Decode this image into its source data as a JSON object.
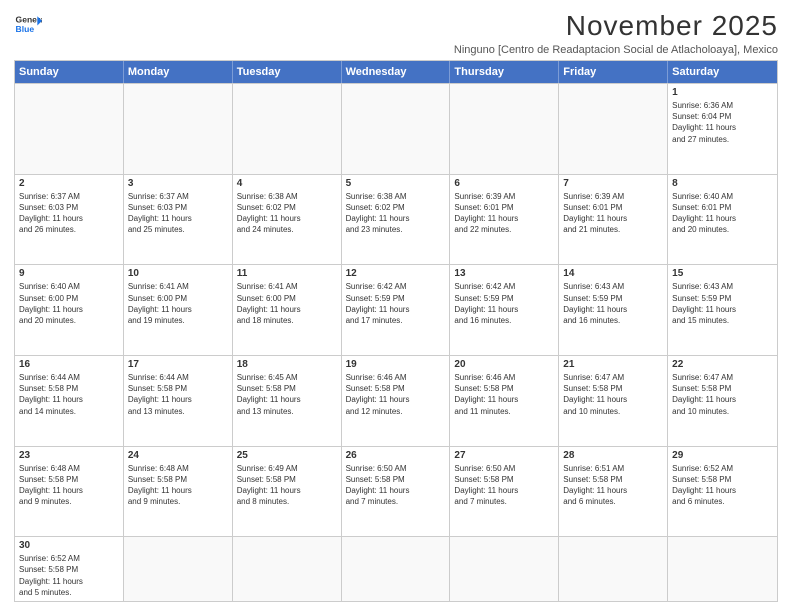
{
  "logo": {
    "line1": "General",
    "line2": "Blue"
  },
  "title": "November 2025",
  "subtitle": "Ninguno [Centro de Readaptacion Social de Atlacholoaya], Mexico",
  "days": [
    "Sunday",
    "Monday",
    "Tuesday",
    "Wednesday",
    "Thursday",
    "Friday",
    "Saturday"
  ],
  "rows": [
    [
      {
        "day": "",
        "info": ""
      },
      {
        "day": "",
        "info": ""
      },
      {
        "day": "",
        "info": ""
      },
      {
        "day": "",
        "info": ""
      },
      {
        "day": "",
        "info": ""
      },
      {
        "day": "",
        "info": ""
      },
      {
        "day": "1",
        "info": "Sunrise: 6:36 AM\nSunset: 6:04 PM\nDaylight: 11 hours\nand 27 minutes."
      }
    ],
    [
      {
        "day": "2",
        "info": "Sunrise: 6:37 AM\nSunset: 6:03 PM\nDaylight: 11 hours\nand 26 minutes."
      },
      {
        "day": "3",
        "info": "Sunrise: 6:37 AM\nSunset: 6:03 PM\nDaylight: 11 hours\nand 25 minutes."
      },
      {
        "day": "4",
        "info": "Sunrise: 6:38 AM\nSunset: 6:02 PM\nDaylight: 11 hours\nand 24 minutes."
      },
      {
        "day": "5",
        "info": "Sunrise: 6:38 AM\nSunset: 6:02 PM\nDaylight: 11 hours\nand 23 minutes."
      },
      {
        "day": "6",
        "info": "Sunrise: 6:39 AM\nSunset: 6:01 PM\nDaylight: 11 hours\nand 22 minutes."
      },
      {
        "day": "7",
        "info": "Sunrise: 6:39 AM\nSunset: 6:01 PM\nDaylight: 11 hours\nand 21 minutes."
      },
      {
        "day": "8",
        "info": "Sunrise: 6:40 AM\nSunset: 6:01 PM\nDaylight: 11 hours\nand 20 minutes."
      }
    ],
    [
      {
        "day": "9",
        "info": "Sunrise: 6:40 AM\nSunset: 6:00 PM\nDaylight: 11 hours\nand 20 minutes."
      },
      {
        "day": "10",
        "info": "Sunrise: 6:41 AM\nSunset: 6:00 PM\nDaylight: 11 hours\nand 19 minutes."
      },
      {
        "day": "11",
        "info": "Sunrise: 6:41 AM\nSunset: 6:00 PM\nDaylight: 11 hours\nand 18 minutes."
      },
      {
        "day": "12",
        "info": "Sunrise: 6:42 AM\nSunset: 5:59 PM\nDaylight: 11 hours\nand 17 minutes."
      },
      {
        "day": "13",
        "info": "Sunrise: 6:42 AM\nSunset: 5:59 PM\nDaylight: 11 hours\nand 16 minutes."
      },
      {
        "day": "14",
        "info": "Sunrise: 6:43 AM\nSunset: 5:59 PM\nDaylight: 11 hours\nand 16 minutes."
      },
      {
        "day": "15",
        "info": "Sunrise: 6:43 AM\nSunset: 5:59 PM\nDaylight: 11 hours\nand 15 minutes."
      }
    ],
    [
      {
        "day": "16",
        "info": "Sunrise: 6:44 AM\nSunset: 5:58 PM\nDaylight: 11 hours\nand 14 minutes."
      },
      {
        "day": "17",
        "info": "Sunrise: 6:44 AM\nSunset: 5:58 PM\nDaylight: 11 hours\nand 13 minutes."
      },
      {
        "day": "18",
        "info": "Sunrise: 6:45 AM\nSunset: 5:58 PM\nDaylight: 11 hours\nand 13 minutes."
      },
      {
        "day": "19",
        "info": "Sunrise: 6:46 AM\nSunset: 5:58 PM\nDaylight: 11 hours\nand 12 minutes."
      },
      {
        "day": "20",
        "info": "Sunrise: 6:46 AM\nSunset: 5:58 PM\nDaylight: 11 hours\nand 11 minutes."
      },
      {
        "day": "21",
        "info": "Sunrise: 6:47 AM\nSunset: 5:58 PM\nDaylight: 11 hours\nand 10 minutes."
      },
      {
        "day": "22",
        "info": "Sunrise: 6:47 AM\nSunset: 5:58 PM\nDaylight: 11 hours\nand 10 minutes."
      }
    ],
    [
      {
        "day": "23",
        "info": "Sunrise: 6:48 AM\nSunset: 5:58 PM\nDaylight: 11 hours\nand 9 minutes."
      },
      {
        "day": "24",
        "info": "Sunrise: 6:48 AM\nSunset: 5:58 PM\nDaylight: 11 hours\nand 9 minutes."
      },
      {
        "day": "25",
        "info": "Sunrise: 6:49 AM\nSunset: 5:58 PM\nDaylight: 11 hours\nand 8 minutes."
      },
      {
        "day": "26",
        "info": "Sunrise: 6:50 AM\nSunset: 5:58 PM\nDaylight: 11 hours\nand 7 minutes."
      },
      {
        "day": "27",
        "info": "Sunrise: 6:50 AM\nSunset: 5:58 PM\nDaylight: 11 hours\nand 7 minutes."
      },
      {
        "day": "28",
        "info": "Sunrise: 6:51 AM\nSunset: 5:58 PM\nDaylight: 11 hours\nand 6 minutes."
      },
      {
        "day": "29",
        "info": "Sunrise: 6:52 AM\nSunset: 5:58 PM\nDaylight: 11 hours\nand 6 minutes."
      }
    ],
    [
      {
        "day": "30",
        "info": "Sunrise: 6:52 AM\nSunset: 5:58 PM\nDaylight: 11 hours\nand 5 minutes."
      },
      {
        "day": "",
        "info": ""
      },
      {
        "day": "",
        "info": ""
      },
      {
        "day": "",
        "info": ""
      },
      {
        "day": "",
        "info": ""
      },
      {
        "day": "",
        "info": ""
      },
      {
        "day": "",
        "info": ""
      }
    ]
  ]
}
